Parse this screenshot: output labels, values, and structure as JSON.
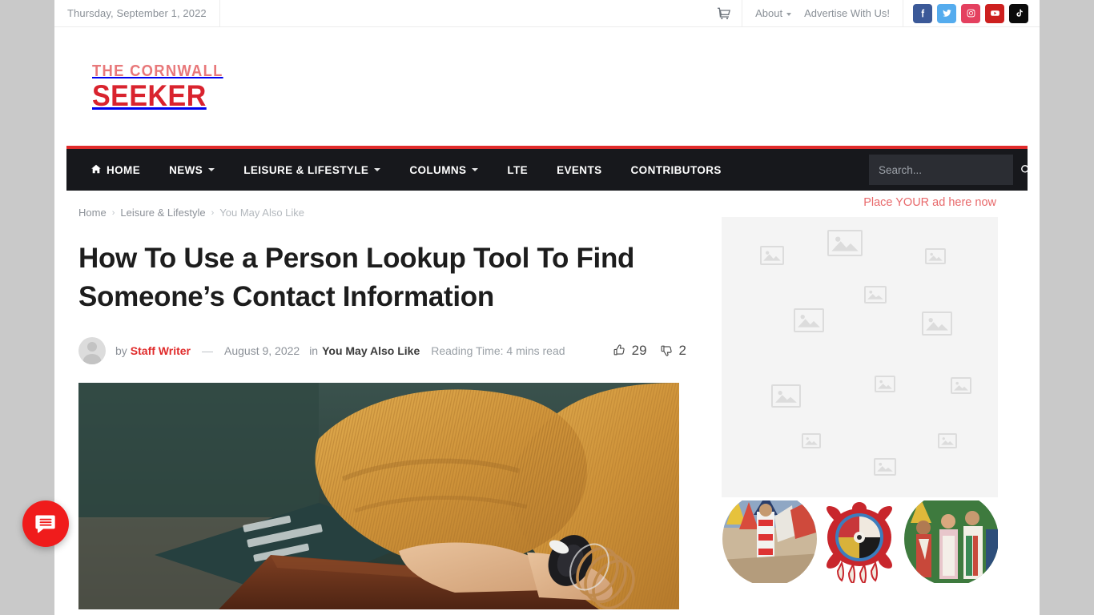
{
  "topbar": {
    "date": "Thursday, September 1, 2022",
    "cart_icon": "shopping-cart-icon",
    "links": [
      {
        "label": "About",
        "has_caret": true
      },
      {
        "label": "Advertise With Us!",
        "has_caret": false
      }
    ],
    "socials": [
      {
        "name": "facebook",
        "color": "#3b5998"
      },
      {
        "name": "twitter",
        "color": "#55acee"
      },
      {
        "name": "instagram",
        "color": "#e4405f"
      },
      {
        "name": "youtube",
        "color": "#cd201f"
      },
      {
        "name": "tiktok",
        "color": "#0b0b0b"
      }
    ]
  },
  "logo": {
    "line1": "THE CORNWALL",
    "line2": "SEEKER",
    "color_line1": "#e8787a",
    "color_line2": "#d9232e"
  },
  "nav": {
    "accent_color": "#e02b2b",
    "background": "#17181c",
    "items": [
      {
        "label": "HOME",
        "icon": "home-icon",
        "has_caret": false
      },
      {
        "label": "NEWS",
        "icon": "",
        "has_caret": true
      },
      {
        "label": "LEISURE & LIFESTYLE",
        "icon": "",
        "has_caret": true
      },
      {
        "label": "COLUMNS",
        "icon": "",
        "has_caret": true
      },
      {
        "label": "LTE",
        "icon": "",
        "has_caret": false
      },
      {
        "label": "EVENTS",
        "icon": "",
        "has_caret": false
      },
      {
        "label": "CONTRIBUTORS",
        "icon": "",
        "has_caret": false
      }
    ],
    "search": {
      "placeholder": "Search...",
      "value": "",
      "icon": "search-icon"
    }
  },
  "breadcrumb": [
    {
      "label": "Home",
      "current": false
    },
    {
      "label": "Leisure & Lifestyle",
      "current": false
    },
    {
      "label": "You May Also Like",
      "current": true
    }
  ],
  "article": {
    "title": "How To Use a Person Lookup Tool To Find Someone’s Contact Information",
    "by_label": "by",
    "author": "Staff Writer",
    "dash": "—",
    "date": "August 9, 2022",
    "in_label": "in",
    "category": "You May Also Like",
    "reading_time": "Reading Time: 4 mins read",
    "avatar": "default-avatar",
    "reactions": {
      "like_icon": "thumbs-up-icon",
      "like_count": "29",
      "dislike_icon": "thumbs-down-icon",
      "dislike_count": "2"
    },
    "featured_image_alt": "Hands in a mustard knit sweater with bangle bracelets resting on a wooden table"
  },
  "sidebar": {
    "ad_label": "Place YOUR ad here now",
    "ad_label_color": "#e8696b",
    "ad_placeholder_icon": "broken-image-icon",
    "banner_alt": "Powwow dancers in regalia with a red turtle medicine-wheel emblem"
  },
  "chat": {
    "icon": "chat-bubble-icon",
    "color": "#f01c1c"
  }
}
